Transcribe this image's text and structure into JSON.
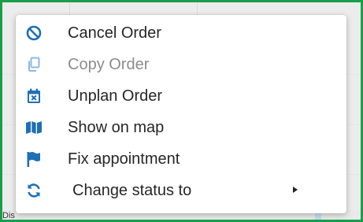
{
  "colors": {
    "frame": "#1a9e4a",
    "icon": "#1f6fb5",
    "icon_disabled": "#8fb8e0",
    "text": "#262626",
    "text_disabled": "#8c8c8c"
  },
  "bottom": {
    "label": "Dis"
  },
  "menu": {
    "items": [
      {
        "label": "Cancel Order",
        "icon": "ban-icon",
        "disabled": false
      },
      {
        "label": "Copy Order",
        "icon": "copy-icon",
        "disabled": true
      },
      {
        "label": "Unplan Order",
        "icon": "calendar-x-icon",
        "disabled": false
      },
      {
        "label": "Show on map",
        "icon": "map-icon",
        "disabled": false
      },
      {
        "label": "Fix appointment",
        "icon": "flag-icon",
        "disabled": false
      },
      {
        "label": "Change status to",
        "icon": "refresh-icon",
        "disabled": false,
        "submenu": true
      }
    ]
  }
}
